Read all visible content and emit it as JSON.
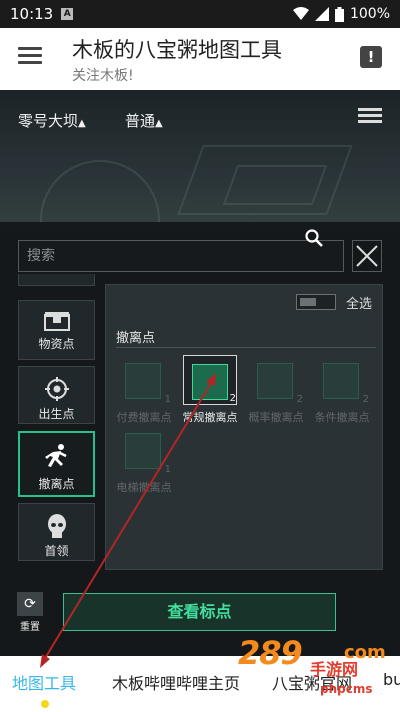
{
  "status_bar": {
    "time": "10:13",
    "sim_badge": "A",
    "battery": "100%"
  },
  "app": {
    "title": "木板的八宝粥地图工具",
    "subtitle": "关注木板!",
    "report_icon": "!"
  },
  "top_selectors": {
    "map": "零号大坝",
    "difficulty": "普通"
  },
  "search": {
    "placeholder": "搜索"
  },
  "categories": [
    {
      "label": "物资点",
      "icon": "supply-box-icon"
    },
    {
      "label": "出生点",
      "icon": "spawn-target-icon"
    },
    {
      "label": "撤离点",
      "icon": "runner-icon",
      "active": true
    },
    {
      "label": "首领",
      "icon": "skull-icon"
    }
  ],
  "content": {
    "select_all": "全选",
    "section_title": "撤离点",
    "items": [
      {
        "label": "付费撤离点",
        "count": "1",
        "selected": false
      },
      {
        "label": "常规撤离点",
        "count": "2",
        "selected": true
      },
      {
        "label": "概率撤离点",
        "count": "2",
        "selected": false
      },
      {
        "label": "条件撤离点",
        "count": "2",
        "selected": false
      },
      {
        "label": "电梯撤离点",
        "count": "1",
        "selected": false
      }
    ]
  },
  "actions": {
    "reset": "重置",
    "view_markers": "查看标点"
  },
  "tabs": [
    {
      "label": "地图工具",
      "active": true
    },
    {
      "label": "木板哔哩哔哩主页",
      "active": false
    },
    {
      "label": "八宝粥官网",
      "active": false
    },
    {
      "label": "bu",
      "active": false
    }
  ],
  "watermark": {
    "logo": "289",
    "logo_suffix": "com",
    "name": "手游网",
    "url": "phpcms"
  },
  "colors": {
    "accent_green": "#43df9e",
    "tab_active": "#38b6e8",
    "dot": "#f6d51b",
    "arrow": "#b32525"
  }
}
